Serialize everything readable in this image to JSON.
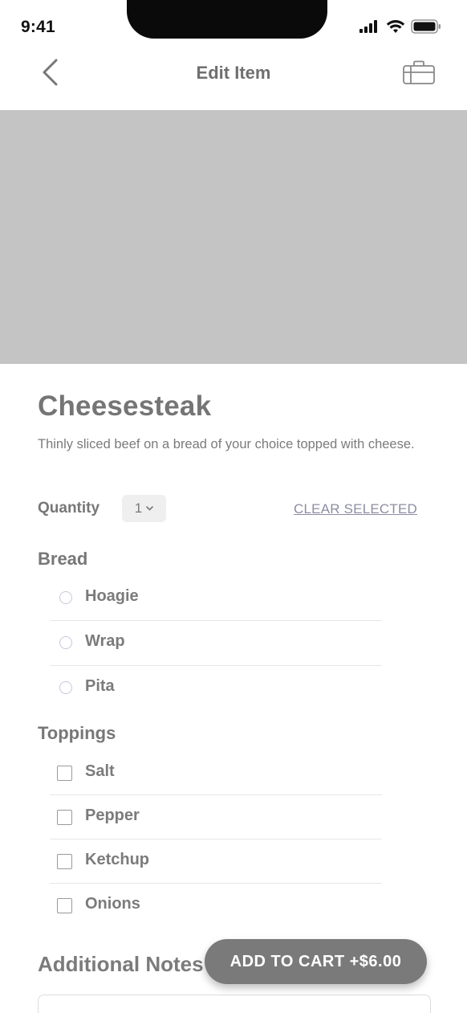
{
  "status_bar": {
    "time": "9:41"
  },
  "nav": {
    "title": "Edit Item"
  },
  "item": {
    "name": "Cheesesteak",
    "description": "Thinly sliced beef on a bread of your choice topped with cheese."
  },
  "quantity": {
    "label": "Quantity",
    "value": "1",
    "clear_label": "CLEAR SELECTED"
  },
  "bread": {
    "title": "Bread",
    "options": [
      {
        "label": "Hoagie",
        "selected": false
      },
      {
        "label": "Wrap",
        "selected": false
      },
      {
        "label": "Pita",
        "selected": false
      }
    ]
  },
  "toppings": {
    "title": "Toppings",
    "options": [
      {
        "label": "Salt",
        "checked": false
      },
      {
        "label": "Pepper",
        "checked": false
      },
      {
        "label": "Ketchup",
        "checked": false
      },
      {
        "label": "Onions",
        "checked": false
      }
    ]
  },
  "notes": {
    "title": "Additional Notes"
  },
  "cta": {
    "label": "ADD TO CART +$6.00"
  },
  "colors": {
    "hero_placeholder": "#c4c4c4",
    "cta_background": "#7a7a7a",
    "link": "#8d8da3",
    "radio_border": "#c7c7dc"
  },
  "icons": {
    "back": "chevron-left-icon",
    "cart": "shopping-bag-icon",
    "signal": "signal-icon",
    "wifi": "wifi-icon",
    "battery": "battery-icon",
    "dropdown": "chevron-down-icon"
  }
}
